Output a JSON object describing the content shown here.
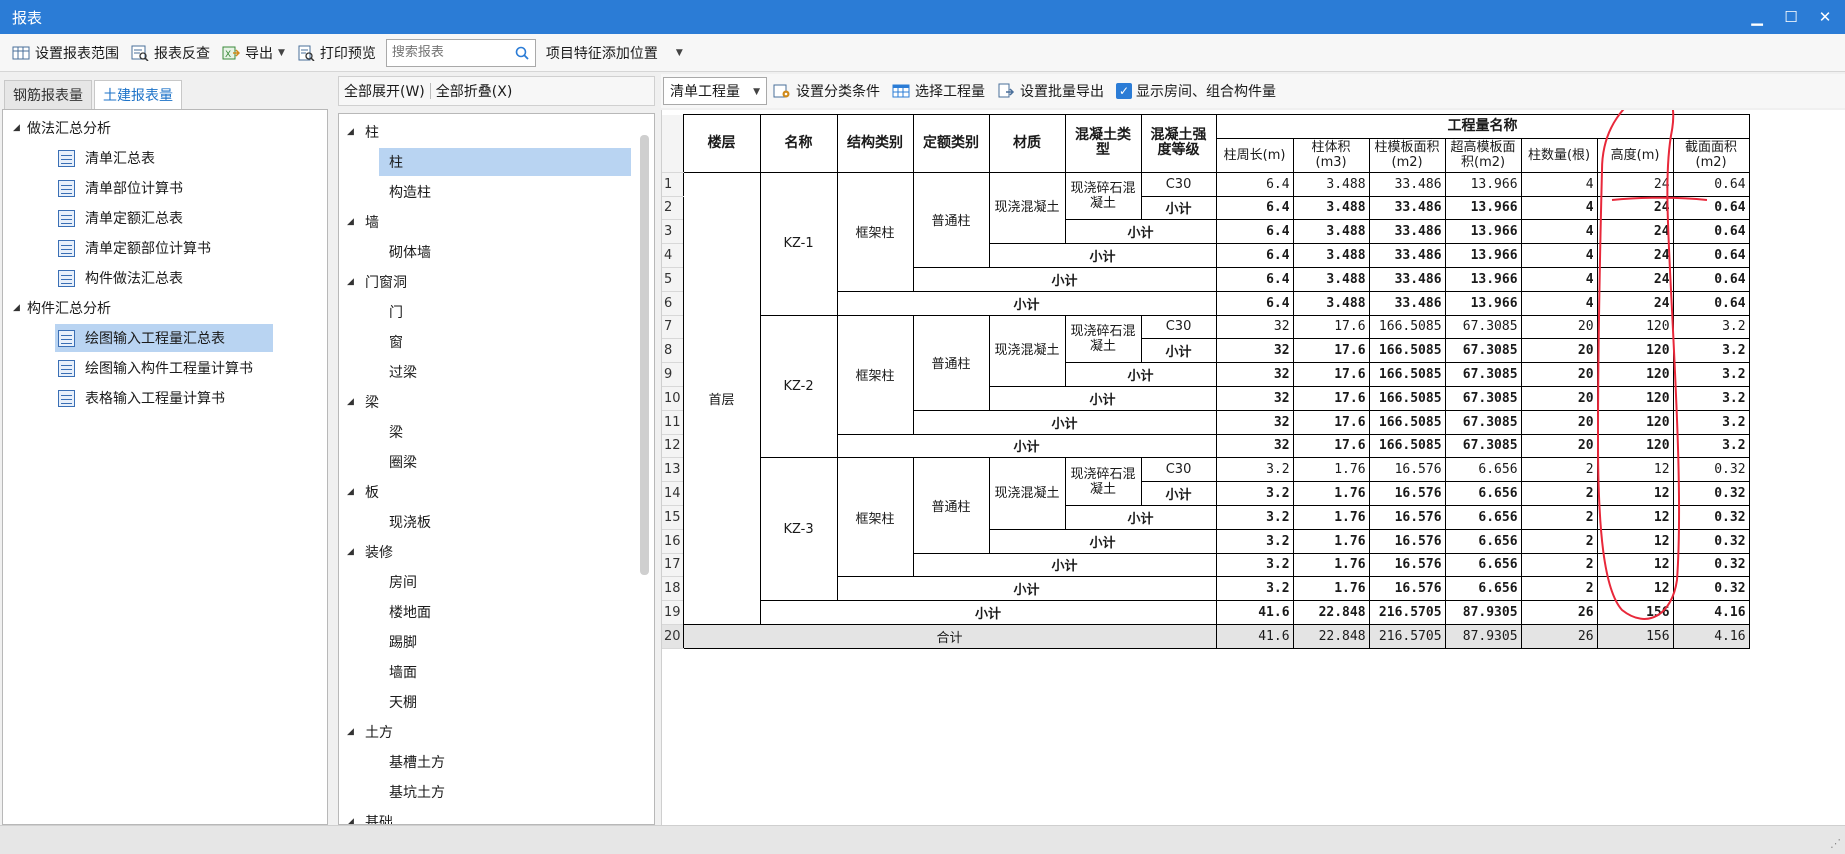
{
  "window": {
    "title": "报表",
    "minimize": "▁",
    "maximize": "☐",
    "close": "✕"
  },
  "toolbar": {
    "range": "设置报表范围",
    "reverse": "报表反查",
    "export": "导出",
    "preview": "打印预览",
    "search_placeholder": "搜索报表",
    "feature_pos": "项目特征添加位置"
  },
  "left_tabs": [
    {
      "label": "钢筋报表量"
    },
    {
      "label": "土建报表量"
    }
  ],
  "left_tree": {
    "group1": "做法汇总分析",
    "g1_items": [
      "清单汇总表",
      "清单部位计算书",
      "清单定额汇总表",
      "清单定额部位计算书",
      "构件做法汇总表"
    ],
    "group2": "构件汇总分析",
    "g2_items": [
      "绘图输入工程量汇总表",
      "绘图输入构件工程量计算书",
      "表格输入工程量计算书"
    ]
  },
  "mid": {
    "expand_all": "全部展开(W)",
    "collapse_all": "全部折叠(X)",
    "tree": [
      {
        "label": "柱",
        "level": 0
      },
      {
        "label": "柱",
        "level": 1
      },
      {
        "label": "构造柱",
        "level": 1
      },
      {
        "label": "墙",
        "level": 0
      },
      {
        "label": "砌体墙",
        "level": 1
      },
      {
        "label": "门窗洞",
        "level": 0
      },
      {
        "label": "门",
        "level": 1
      },
      {
        "label": "窗",
        "level": 1
      },
      {
        "label": "过梁",
        "level": 1
      },
      {
        "label": "梁",
        "level": 0
      },
      {
        "label": "梁",
        "level": 1
      },
      {
        "label": "圈梁",
        "level": 1
      },
      {
        "label": "板",
        "level": 0
      },
      {
        "label": "现浇板",
        "level": 1
      },
      {
        "label": "装修",
        "level": 0
      },
      {
        "label": "房间",
        "level": 1
      },
      {
        "label": "楼地面",
        "level": 1
      },
      {
        "label": "踢脚",
        "level": 1
      },
      {
        "label": "墙面",
        "level": 1
      },
      {
        "label": "天棚",
        "level": 1
      },
      {
        "label": "土方",
        "level": 0
      },
      {
        "label": "基槽土方",
        "level": 1
      },
      {
        "label": "基坑土方",
        "level": 1
      },
      {
        "label": "基础",
        "level": 0
      }
    ]
  },
  "right_toolbar": {
    "select_value": "清单工程量",
    "classify": "设置分类条件",
    "choose_qty": "选择工程量",
    "batch_export": "设置批量导出",
    "show_rooms": "显示房间、组合构件量"
  },
  "report": {
    "headers": {
      "floor": "楼层",
      "name": "名称",
      "struct": "结构类别",
      "quota": "定额类别",
      "material": "材质",
      "conc_type": "混凝土类型",
      "conc_grade": "混凝土强度等级",
      "qty_group": "工程量名称",
      "perimeter": "柱周长(m)",
      "volume": "柱体积(m3)",
      "formwork": "柱模板面积(m2)",
      "high_formwork": "超高模板面积(m2)",
      "count": "柱数量(根)",
      "height": "高度(m)",
      "section": "截面面积(m2)"
    },
    "floor": "首层",
    "struct_label": "框架柱",
    "quota_label": "普通柱",
    "material_label": "现浇混凝土",
    "conc_type_label": "现浇碎石混凝土",
    "grade_label": "C30",
    "subtotal": "小计",
    "total": "合计",
    "row_numbers": [
      "1",
      "2",
      "3",
      "4",
      "5",
      "6",
      "7",
      "8",
      "9",
      "10",
      "11",
      "12",
      "13",
      "14",
      "15",
      "16",
      "17",
      "18",
      "19",
      "20"
    ],
    "groups": [
      {
        "name": "KZ-1",
        "values": [
          "6.4",
          "3.488",
          "33.486",
          "13.966",
          "4",
          "24",
          "0.64"
        ]
      },
      {
        "name": "KZ-2",
        "values": [
          "32",
          "17.6",
          "166.5085",
          "67.3085",
          "20",
          "120",
          "3.2"
        ]
      },
      {
        "name": "KZ-3",
        "values": [
          "3.2",
          "1.76",
          "16.576",
          "6.656",
          "2",
          "12",
          "0.32"
        ]
      }
    ],
    "floor_subtotal": [
      "41.6",
      "22.848",
      "216.5705",
      "87.9305",
      "26",
      "156",
      "4.16"
    ],
    "grand_total": [
      "41.6",
      "22.848",
      "216.5705",
      "87.9305",
      "26",
      "156",
      "4.16"
    ]
  },
  "colors": {
    "titlebar": "#2b7cd6",
    "selection": "#b9d4f2",
    "annotation": "#e8283a"
  }
}
